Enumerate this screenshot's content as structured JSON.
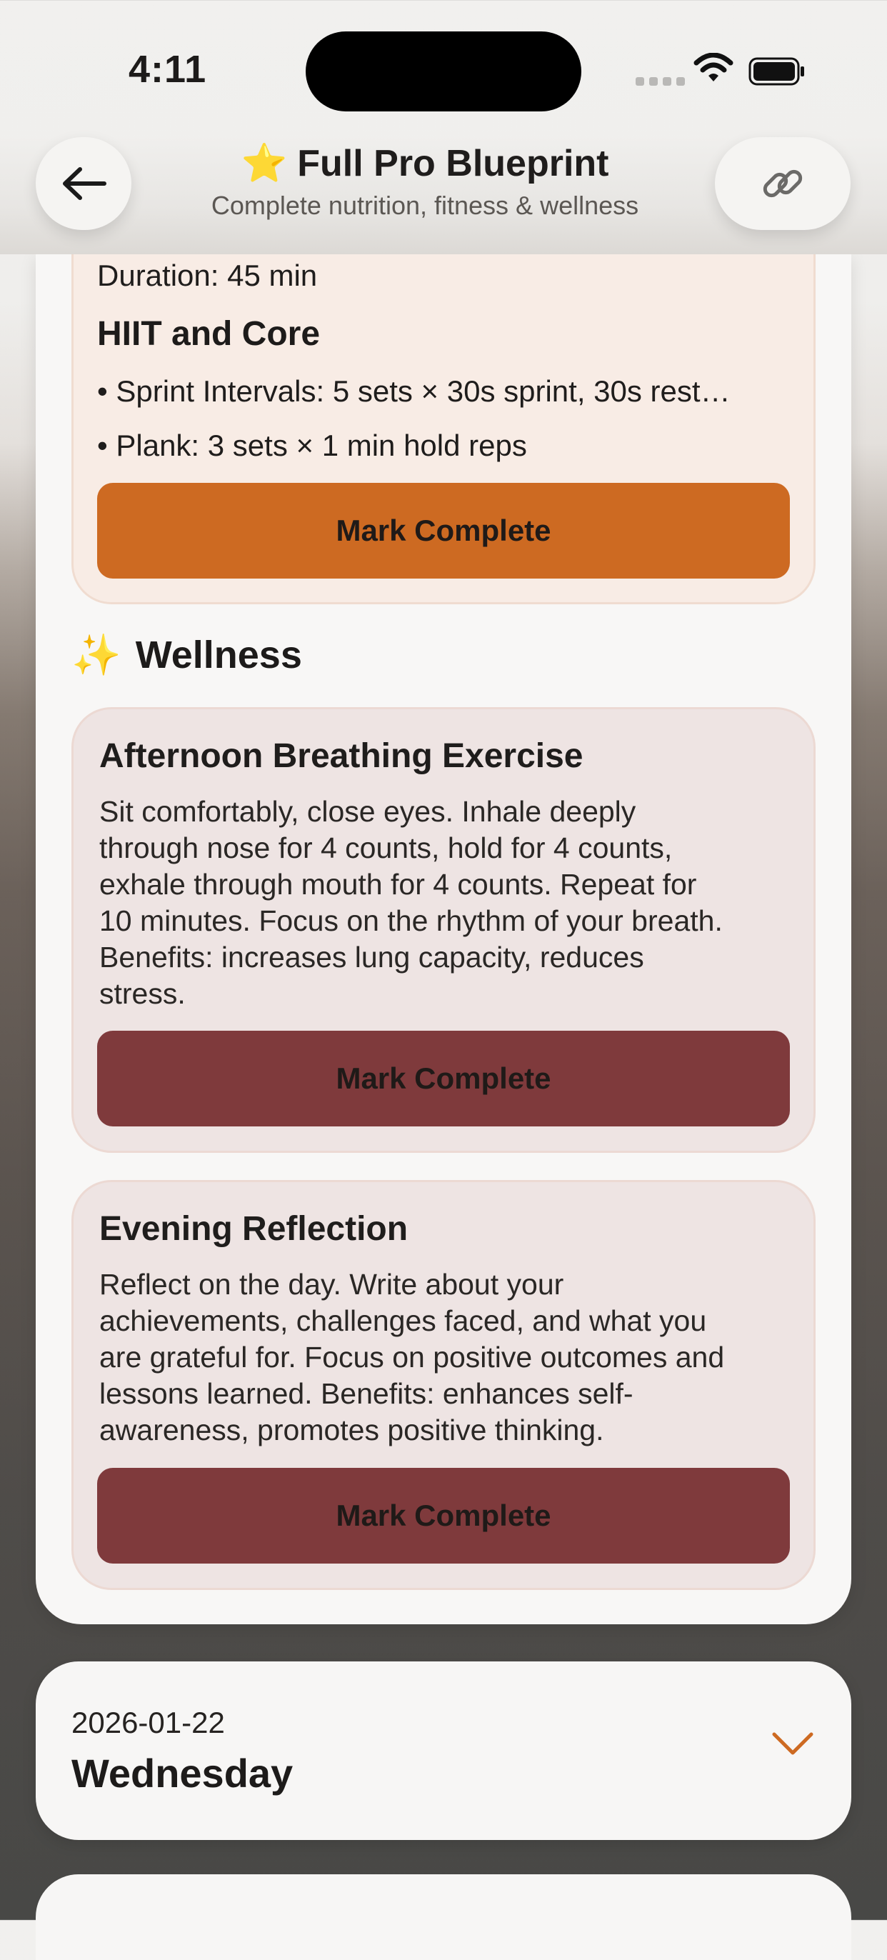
{
  "status_bar": {
    "time": "4:11"
  },
  "header": {
    "title_icon": "⭐",
    "title": "Full Pro Blueprint",
    "subtitle": "Complete nutrition, fitness & wellness",
    "back_icon": "arrow-left-icon",
    "link_icon": "link-icon"
  },
  "fitness": {
    "duration": "Duration: 45 min",
    "workout_name": "HIIT and Core",
    "exercises": [
      "• Sprint Intervals: 5 sets × 30s sprint, 30s rest…",
      "• Plank: 3 sets × 1 min hold reps"
    ],
    "button_label": "Mark Complete"
  },
  "wellness": {
    "section_icon": "✨",
    "section_title": "Wellness",
    "items": [
      {
        "title": "Afternoon Breathing Exercise",
        "lines": [
          "Sit comfortably, close eyes. Inhale deeply",
          "through nose for 4 counts, hold for 4 counts,",
          "exhale through mouth for 4 counts. Repeat for",
          "10 minutes. Focus on the rhythm of your breath.",
          "Benefits: increases lung capacity, reduces",
          "stress."
        ],
        "button_label": "Mark Complete"
      },
      {
        "title": "Evening Reflection",
        "lines": [
          "Reflect on the day. Write about your",
          "achievements, challenges faced, and what you",
          "are grateful for. Focus on positive outcomes and",
          "lessons learned. Benefits: enhances self-",
          "awareness, promotes positive thinking."
        ],
        "button_label": "Mark Complete"
      }
    ]
  },
  "day_card": {
    "date": "2026-01-22",
    "day": "Wednesday",
    "chevron_icon": "chevron-down-icon"
  },
  "colors": {
    "accent_orange": "#cd6a22",
    "wellness_button": "#7f3a3c",
    "fitness_card_bg": "#f8ece5",
    "wellness_card_bg": "#eee4e3"
  }
}
